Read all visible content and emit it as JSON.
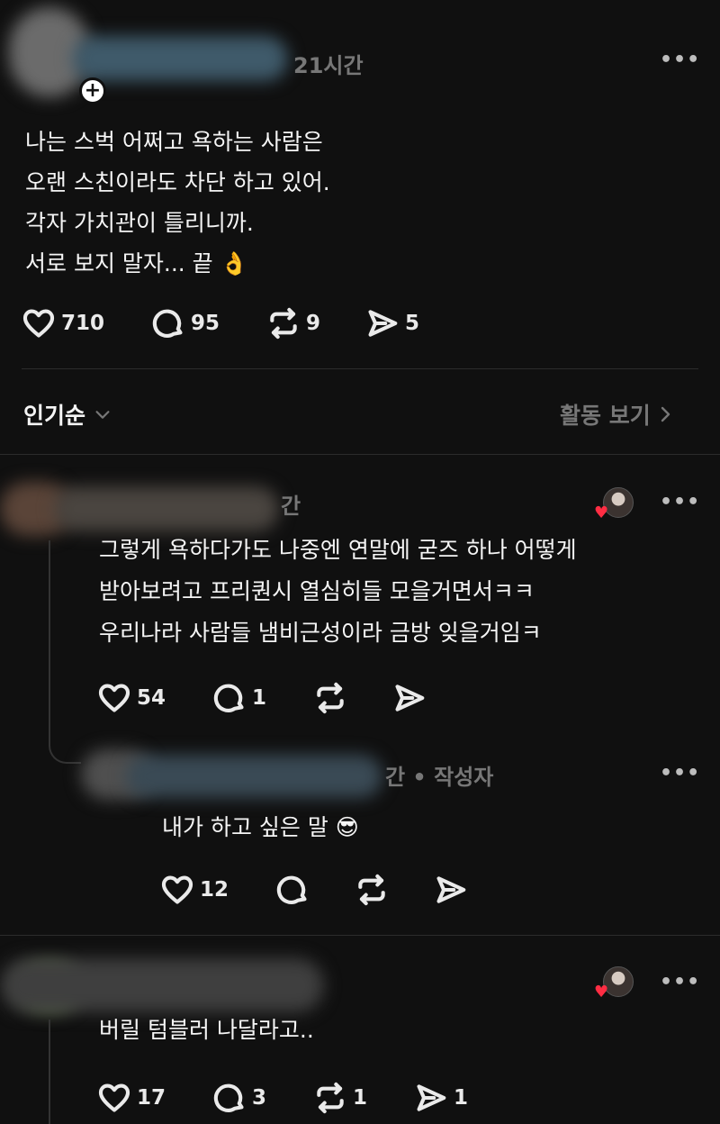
{
  "colors": {
    "background": "#101010",
    "text": "#f3f5f7",
    "muted": "#777777",
    "heart": "#ff2d43"
  },
  "post": {
    "time": "21시간",
    "more_label": "•••",
    "lines": [
      "나는 스벅 어쩌고 욕하는 사람은",
      "오랜 스친이라도 차단 하고 있어.",
      "각자 가치관이 틀리니까.",
      "서로 보지 말자... 끝 👌"
    ],
    "likes": "710",
    "replies": "95",
    "reposts": "9",
    "shares": "5"
  },
  "sort_bar": {
    "sort_label": "인기순",
    "activity_label": "활동 보기"
  },
  "comments": [
    {
      "time": "간",
      "lines": [
        "그렇게 욕하다가도 나중엔 연말에 굳즈 하나 어떻게",
        "받아보려고 프리퀀시 열심히들 모을거면서ㅋㅋ",
        "우리나라 사람들 냄비근성이라 금방 잊을거임ㅋ"
      ],
      "likes": "54",
      "replies": "1"
    },
    {
      "time": "간 • 작성자",
      "lines": [
        "내가 하고 싶은 말 😎"
      ],
      "likes": "12"
    },
    {
      "lines": [
        "버릴 텀블러 나달라고.."
      ],
      "likes": "17",
      "replies": "3",
      "reposts": "1",
      "shares": "1"
    }
  ]
}
